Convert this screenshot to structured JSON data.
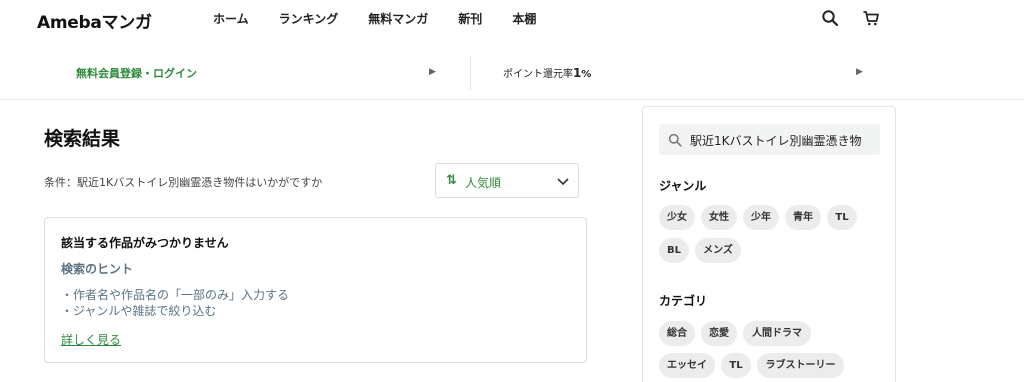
{
  "header": {
    "logo": "Amebaマンガ",
    "nav": [
      "ホーム",
      "ランキング",
      "無料マンガ",
      "新刊",
      "本棚"
    ],
    "icons": [
      "search-icon",
      "cart-icon"
    ]
  },
  "promo": {
    "left_label": "無料会員登録・ログイン",
    "right_label": "ポイント還元率",
    "right_value": "1",
    "right_unit": "%"
  },
  "main": {
    "title": "検索結果",
    "condition": "条件：駅近1Kバストイレ別幽霊憑き物件はいかがですか",
    "sort_label": "人気順",
    "result": {
      "title": "該当する作品がみつかりません",
      "hint_heading": "検索のヒント",
      "hints": [
        "・作者名や作品名の「一部のみ」入力する",
        "・ジャンルや雑誌で絞り込む"
      ],
      "more_link": "詳しく見る"
    }
  },
  "sidebar": {
    "search_value": "駅近1Kバストイレ別幽霊憑き物",
    "genre_title": "ジャンル",
    "genres": [
      "少女",
      "女性",
      "少年",
      "青年",
      "TL",
      "BL",
      "メンズ"
    ],
    "category_title": "カテゴリ",
    "categories": [
      "総合",
      "恋愛",
      "人間ドラマ",
      "エッセイ",
      "TL",
      "ラブストーリー"
    ]
  },
  "colors": {
    "accent_green": "#2e8b3b",
    "hint_slate": "#5b7384",
    "tag_bg": "#ececec"
  }
}
